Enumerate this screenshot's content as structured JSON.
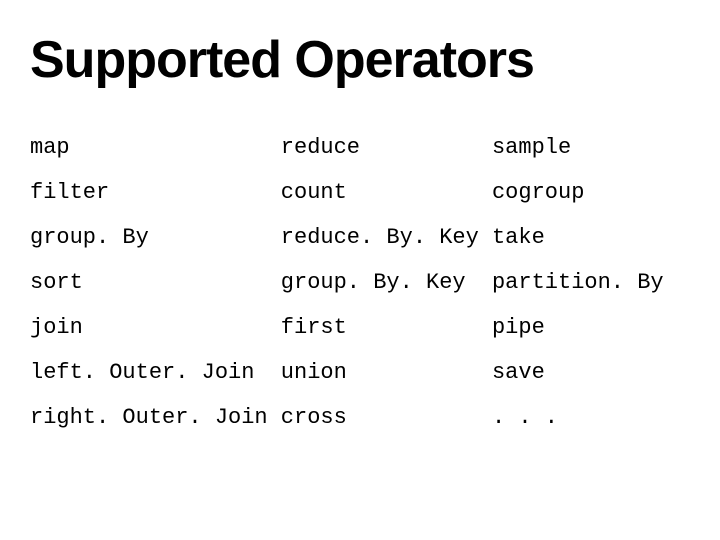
{
  "title": "Supported Operators",
  "rows": [
    {
      "c1": "map",
      "c2": "reduce",
      "c3": "sample"
    },
    {
      "c1": "filter",
      "c2": "count",
      "c3": "cogroup"
    },
    {
      "c1": "group. By",
      "c2": "reduce. By. Key",
      "c3": "take"
    },
    {
      "c1": "sort",
      "c2": "group. By. Key",
      "c3": "partition. By"
    },
    {
      "c1": "join",
      "c2": "first",
      "c3": "pipe"
    },
    {
      "c1": "left. Outer. Join",
      "c2": "union",
      "c3": "save"
    },
    {
      "c1": "right. Outer. Join",
      "c2": "cross",
      "c3": ". . ."
    }
  ]
}
